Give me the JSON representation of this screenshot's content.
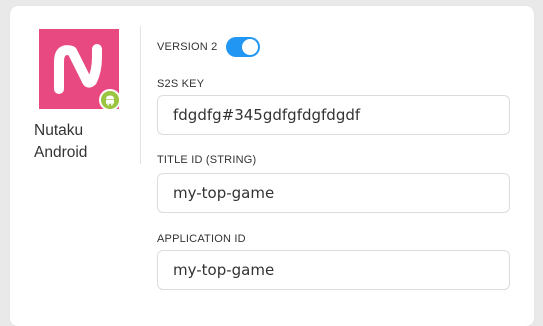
{
  "app": {
    "name_line1": "Nutaku",
    "name_line2": "Android",
    "icon_color": "#e84980",
    "badge_color": "#9bc440",
    "icon": "nutaku-logo-icon",
    "badge_icon": "android-icon"
  },
  "version": {
    "label": "VERSION 2",
    "toggle_on": true,
    "toggle_color": "#2196f3"
  },
  "fields": {
    "s2s_key": {
      "label": "S2S KEY",
      "value": "fdgdfg#345gdfgfdgfdgdf"
    },
    "title_id": {
      "label": "TITLE ID (STRING)",
      "value": "my-top-game"
    },
    "application_id": {
      "label": "APPLICATION ID",
      "value": "my-top-game"
    }
  }
}
